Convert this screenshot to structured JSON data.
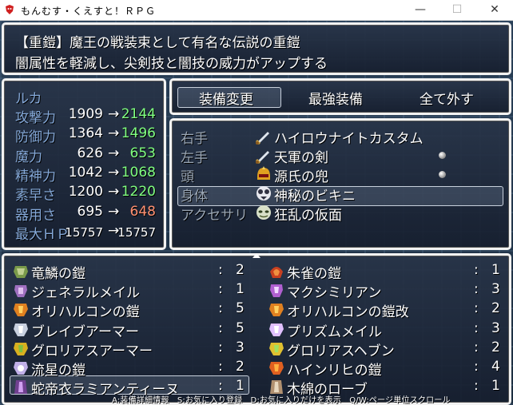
{
  "window": {
    "title": "もんむす・くえすと！ＲＰＧ",
    "minimize": "—",
    "maximize": "☐",
    "close": "✕"
  },
  "help": {
    "line1": "【重鎧】魔王の戦装束として有名な伝説の重鎧",
    "line2": "闇属性を軽減し、尖剣技と闇技の威力がアップする"
  },
  "status": {
    "name": "ルカ",
    "rows": [
      {
        "label": "攻撃力",
        "cur": "1909",
        "arrow": "→",
        "new": "2144",
        "change": "up"
      },
      {
        "label": "防御力",
        "cur": "1364",
        "arrow": "→",
        "new": "1496",
        "change": "up"
      },
      {
        "label": "魔力",
        "cur": "626",
        "arrow": "→",
        "new": "653",
        "change": "up"
      },
      {
        "label": "精神力",
        "cur": "1042",
        "arrow": "→",
        "new": "1068",
        "change": "up"
      },
      {
        "label": "素早さ",
        "cur": "1200",
        "arrow": "→",
        "new": "1220",
        "change": "up"
      },
      {
        "label": "器用さ",
        "cur": "695",
        "arrow": "→",
        "new": "648",
        "change": "down"
      },
      {
        "label": "最大ＨＰ",
        "cur": "15757",
        "arrow": "→",
        "new": "15757",
        "change": "same"
      }
    ]
  },
  "commands": {
    "change": "装備変更",
    "optimize": "最強装備",
    "clear": "全て外す"
  },
  "slots": [
    {
      "slot": "右手",
      "item": "ハイロウナイトカスタム",
      "icon": "sword-icon",
      "lock": false
    },
    {
      "slot": "左手",
      "item": "天軍の剣",
      "icon": "sword-icon",
      "lock": true
    },
    {
      "slot": "頭",
      "item": "源氏の兜",
      "icon": "helmet-icon",
      "lock": true
    },
    {
      "slot": "身体",
      "item": "神秘のビキニ",
      "icon": "bikini-icon",
      "lock": false
    },
    {
      "slot": "アクセサリ",
      "item": "狂乱の仮面",
      "icon": "mask-icon",
      "lock": false
    }
  ],
  "items": [
    {
      "name": "竜鱗の鎧",
      "colon": ":",
      "count": "2",
      "icon": "dragon-armor-icon"
    },
    {
      "name": "朱雀の鎧",
      "colon": ":",
      "count": "1",
      "icon": "bird-armor-icon"
    },
    {
      "name": "ジェネラルメイル",
      "colon": ":",
      "count": "1",
      "icon": "general-mail-icon"
    },
    {
      "name": "マクシミリアン",
      "colon": ":",
      "count": "3",
      "icon": "maximilian-icon"
    },
    {
      "name": "オリハルコンの鎧",
      "colon": ":",
      "count": "5",
      "icon": "orichalcum-armor-icon"
    },
    {
      "name": "オリハルコンの鎧改",
      "colon": ":",
      "count": "2",
      "icon": "orichalcum-armor-icon"
    },
    {
      "name": "ブレイブアーマー",
      "colon": ":",
      "count": "5",
      "icon": "brave-armor-icon"
    },
    {
      "name": "プリズムメイル",
      "colon": ":",
      "count": "3",
      "icon": "prism-mail-icon"
    },
    {
      "name": "グロリアスアーマー",
      "colon": ":",
      "count": "3",
      "icon": "glorious-armor-icon"
    },
    {
      "name": "グロリアスヘブン",
      "colon": ":",
      "count": "2",
      "icon": "glorious-heaven-icon"
    },
    {
      "name": "流星の鎧",
      "colon": ":",
      "count": "2",
      "icon": "meteor-armor-icon"
    },
    {
      "name": "ハインリヒの鎧",
      "colon": ":",
      "count": "4",
      "icon": "heinrich-armor-icon"
    },
    {
      "name": "蛇帝衣ラミアンティーヌ",
      "colon": ":",
      "count": "1",
      "icon": "lamia-robe-icon"
    },
    {
      "name": "木綿のローブ",
      "colon": ":",
      "count": "1",
      "icon": "cotton-robe-icon"
    }
  ],
  "footer": "A:装備詳細情報　S:お気に入り登録　D:お気に入りだけを表示　Q/W:ページ単位スクロール",
  "colors": {
    "system": "#84a8d8",
    "up": "#80ff80",
    "down": "#ff9070",
    "window_border": "#f2f2f2"
  }
}
